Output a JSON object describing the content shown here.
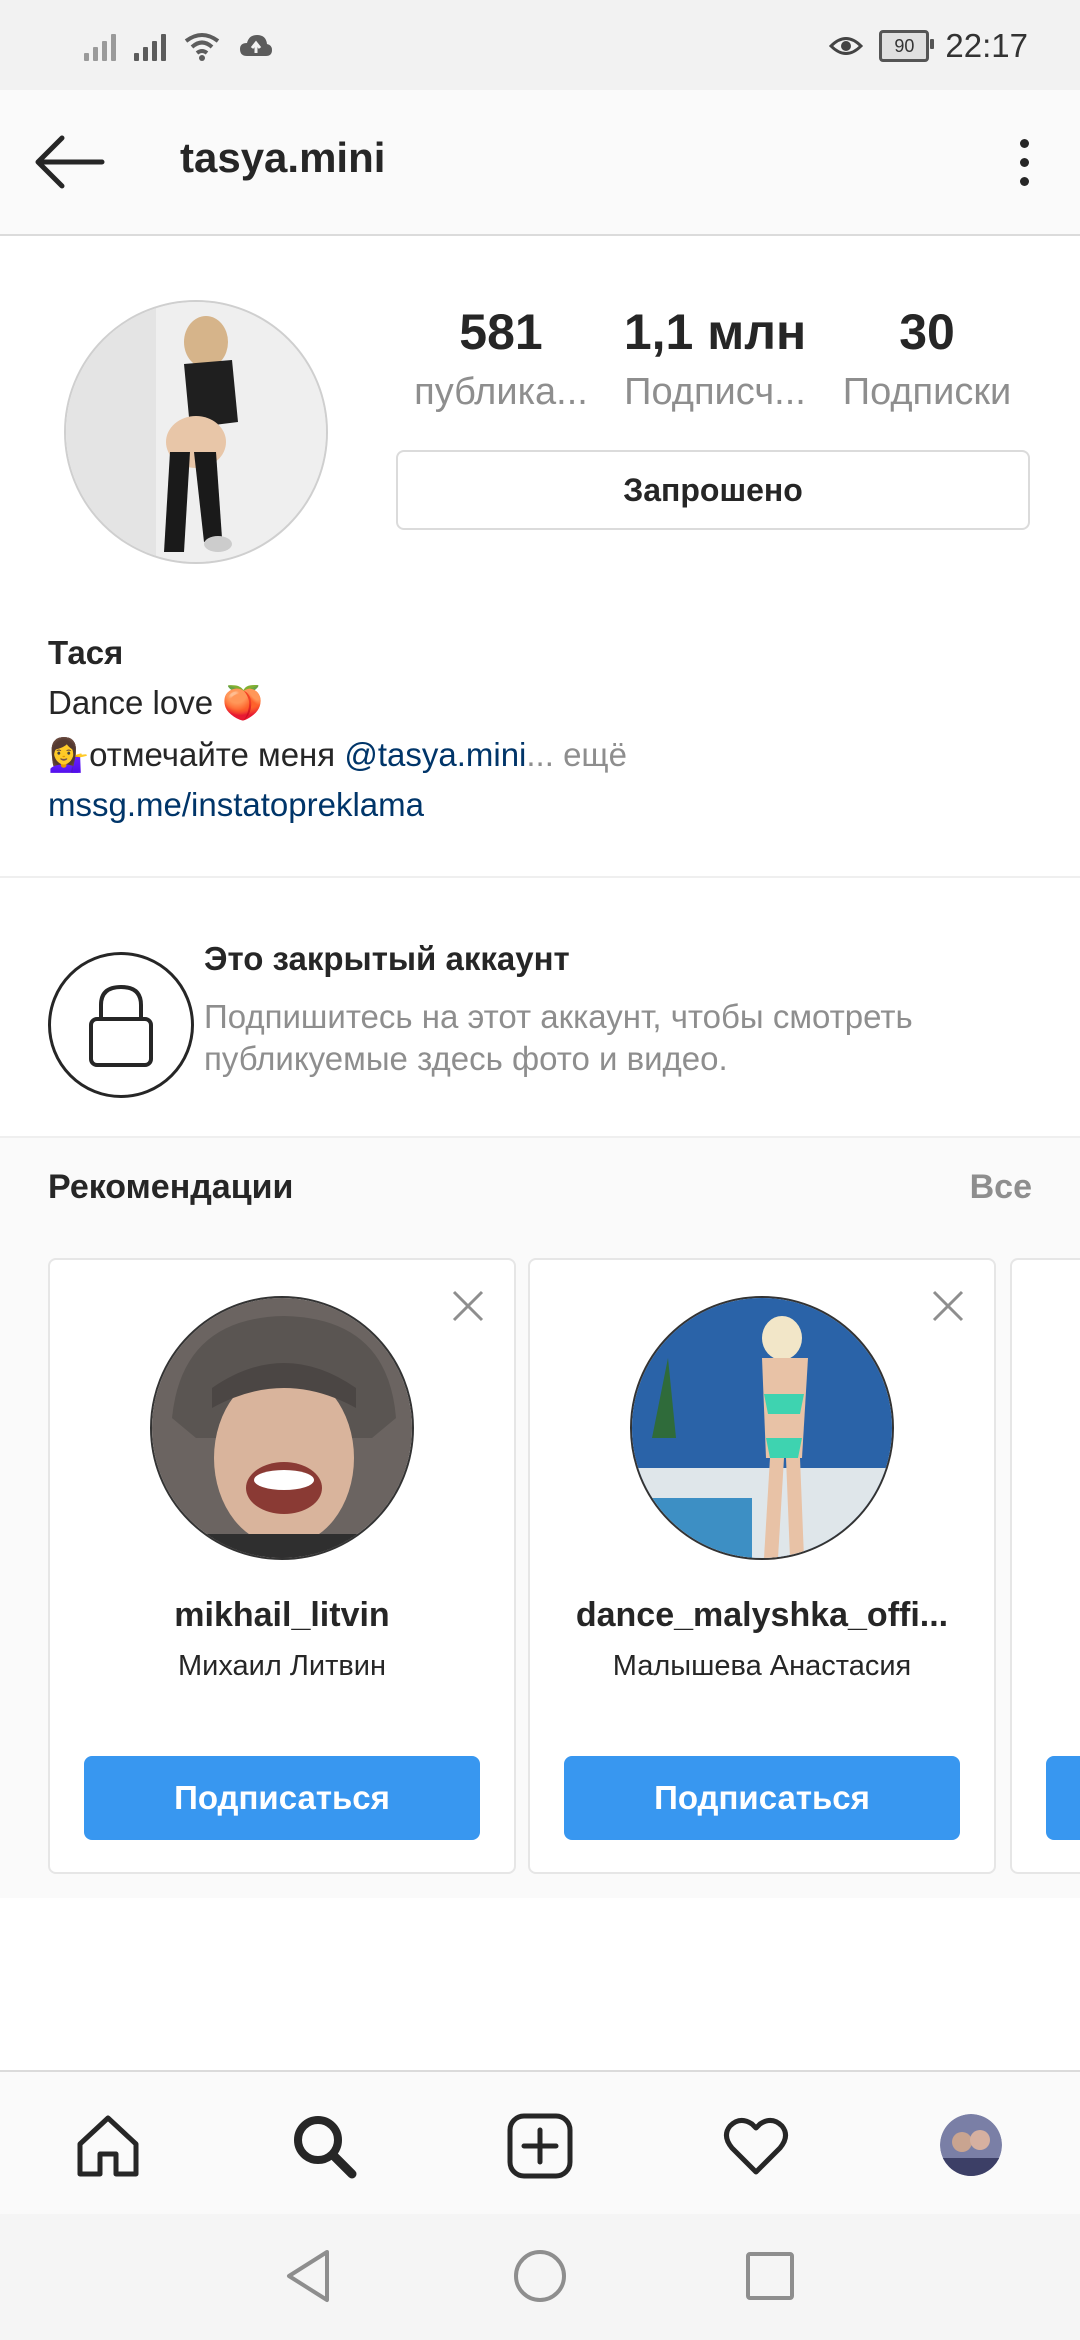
{
  "status_bar": {
    "time": "22:17",
    "battery": "90",
    "icons": [
      "signal-icon",
      "signal-icon",
      "wifi-icon",
      "cloud-upload-icon",
      "eye-icon",
      "battery-icon"
    ]
  },
  "header": {
    "title": "tasya.mini",
    "back_icon": "arrow-left-icon",
    "menu_icon": "more-vertical-icon"
  },
  "profile": {
    "stats": [
      {
        "value": "581",
        "label": "публика..."
      },
      {
        "value": "1,1 млн",
        "label": "Подписч..."
      },
      {
        "value": "30",
        "label": "Подписки"
      }
    ],
    "requested_label": "Запрошено",
    "name": "Тася",
    "bio_line1": "Dance love 🍑",
    "bio_line2_prefix": "💁‍♀️отмечайте меня ",
    "bio_mention": "@tasya.mini",
    "bio_more": "... ещё",
    "bio_link": "mssg.me/instatopreklama"
  },
  "private_notice": {
    "title": "Это закрытый аккаунт",
    "text": "Подпишитесь на этот аккаунт, чтобы смотреть публикуемые здесь фото и видео."
  },
  "recommendations": {
    "title": "Рекомендации",
    "all_label": "Все",
    "cards": [
      {
        "username": "mikhail_litvin",
        "full_name": "Михаил Литвин",
        "follow_label": "Подписаться"
      },
      {
        "username": "dance_malyshka_offi...",
        "full_name": "Малышева Анастасия",
        "follow_label": "Подписаться"
      }
    ]
  },
  "tab_bar": {
    "icons": [
      "home-icon",
      "search-icon",
      "new-post-icon",
      "heart-icon",
      "profile-avatar"
    ]
  },
  "colors": {
    "accent": "#3897f0",
    "link": "#003569",
    "muted": "#8e8e8e",
    "text": "#262626"
  }
}
